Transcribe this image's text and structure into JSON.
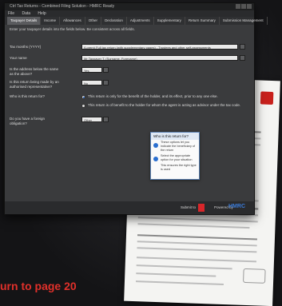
{
  "window": {
    "title": "Ctrl Tax Returns - Combined Filing Solution - HMRC Ready",
    "menu": [
      "File",
      "Data",
      "Help"
    ],
    "tabs": [
      "Taxpayer Details",
      "Income",
      "Allowances",
      "Other",
      "Declaration",
      "Adjustments",
      "Supplementary",
      "Return Summary",
      "Submission Management"
    ],
    "active_tab": 0,
    "intro": "Enter your taxpayer details into the fields below. Be consistent across all fields.",
    "fields": {
      "tax_months_label": "Tax months (YYYY)",
      "tax_months_value": "(Lorem) Full tax return (with supplementary pages) - Trustees and other self-assessments",
      "your_name_label": "Your name",
      "your_name_value": "Mr Taxpayer T. (Surname, Forename)",
      "same_address_label": "Is the address below the same as the above?",
      "same_address_value": "Yes",
      "authorised_label": "Is this return being made by an authorised representative?",
      "authorised_value": "No",
      "who_filed_label": "Who is this return for?",
      "option1": "This return is only for the benefit of the holder, and its effect, prior to any one else.",
      "option2": "This return is of benefit to the holder for whom the agent is acting as advisor under the tax code.",
      "more_label": "Do you have a foreign obligation?",
      "more_value": "Other"
    },
    "popup": {
      "title": "Who is this return for?",
      "items": [
        "These options let you indicate the beneficiary of the return",
        "Select the appropriate option for your situation",
        "This ensures the right type is used"
      ]
    },
    "footer": {
      "submit": "Submit to",
      "powered": "Powered by",
      "hmrc": "HMRC"
    }
  },
  "caption": "urn to page 20"
}
